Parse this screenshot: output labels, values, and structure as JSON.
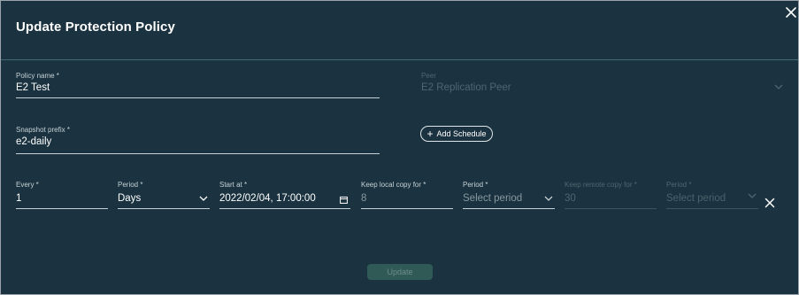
{
  "dialog": {
    "title": "Update Protection Policy",
    "close_icon": "close-icon",
    "colors": {
      "background": "#1b3340",
      "divider": "#3f6b72",
      "button_disabled": "#305a55"
    }
  },
  "policy_name": {
    "label": "Policy name *",
    "value": "E2 Test"
  },
  "peer": {
    "label": "Peer",
    "value": "E2 Replication Peer",
    "icon": "chevron-down-icon",
    "disabled": true
  },
  "snapshot_prefix": {
    "label": "Snapshot prefix *",
    "value": "e2-daily"
  },
  "add_schedule": {
    "label": "Add Schedule",
    "icon": "plus-icon"
  },
  "schedule": {
    "every": {
      "label": "Every *",
      "value": "1"
    },
    "period": {
      "label": "Period *",
      "value": "Days",
      "icon": "chevron-down-icon"
    },
    "start_at": {
      "label": "Start at *",
      "value": "2022/02/04, 17:00:00",
      "icon": "calendar-icon"
    },
    "keep_local": {
      "label": "Keep local copy for *",
      "value": "8"
    },
    "local_period": {
      "label": "Period *",
      "placeholder": "Select period",
      "icon": "chevron-down-icon"
    },
    "keep_remote": {
      "label": "Keep remote copy for *",
      "value": "30",
      "disabled": true
    },
    "remote_period": {
      "label": "Period *",
      "placeholder": "Select period",
      "icon": "chevron-down-icon",
      "disabled": true
    },
    "remove_icon": "close-icon"
  },
  "footer": {
    "update_label": "Update",
    "disabled": true
  }
}
